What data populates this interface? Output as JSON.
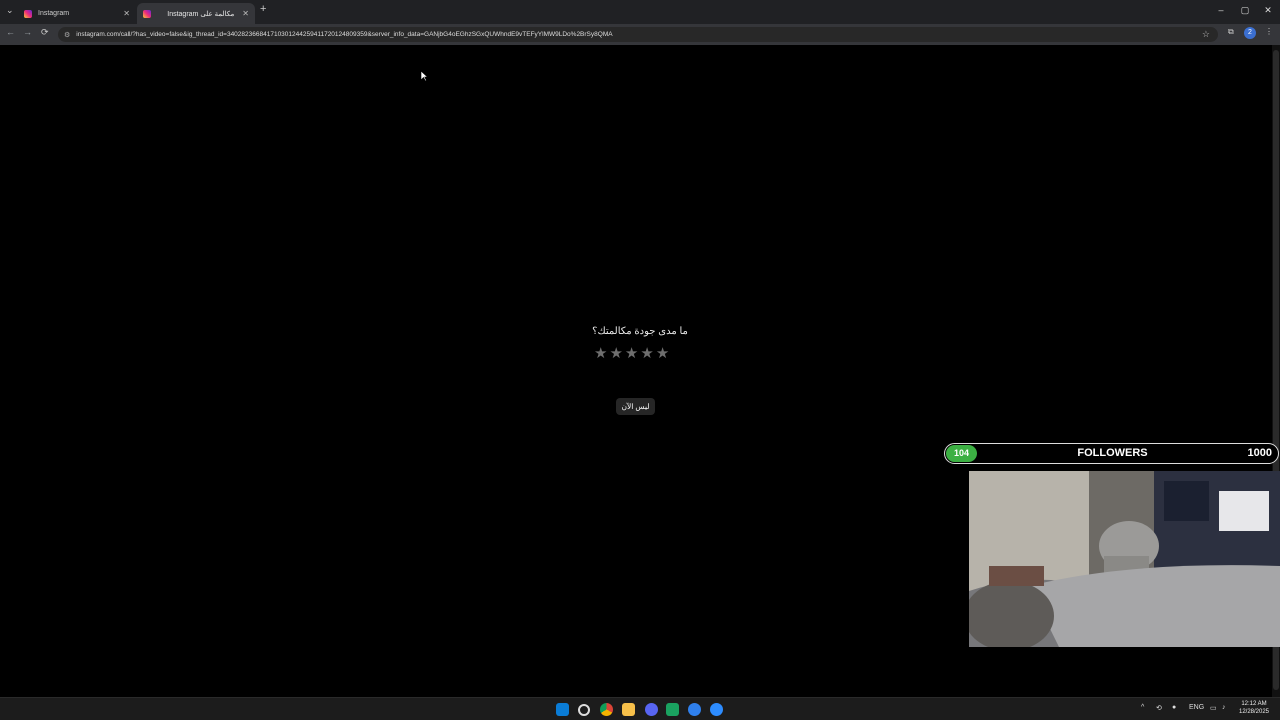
{
  "browser": {
    "tabs": [
      {
        "title": "Instagram",
        "active": false
      },
      {
        "title": "Instagram مكالمة على",
        "active": true
      }
    ],
    "new_tab": "+",
    "url": "instagram.com/call/?has_video=false&ig_thread_id=340282366841710301244259411720124809359&server_info_data=GANjbG4oEGhzSGxQUWhndE9vTEFyYlMW9LDo%2BrSy8QMA",
    "window_controls": {
      "minimize": "–",
      "maximize": "▢",
      "close": "✕"
    }
  },
  "call_feedback": {
    "question": "ما مدى جودة مكالمتك؟",
    "stars": [
      "★",
      "★",
      "★",
      "★",
      "★"
    ],
    "rating": 0,
    "max_rating": 5,
    "not_now_label": "ليس الآن"
  },
  "overlay": {
    "followers_count": "104",
    "followers_label": "FOLLOWERS",
    "followers_goal": "1000",
    "progress": 0.104
  },
  "taskbar": {
    "language": "ENG",
    "time": "12:12 AM",
    "date": "12/28/2025",
    "apps": [
      "start-icon",
      "search-icon",
      "chrome-icon",
      "file-explorer-icon",
      "discord-icon",
      "spotify-icon",
      "browser-icon",
      "zoom-icon"
    ]
  },
  "colors": {
    "followers_badge": "#3cb043",
    "tab_bar": "#202124",
    "toolbar": "#35363a"
  }
}
